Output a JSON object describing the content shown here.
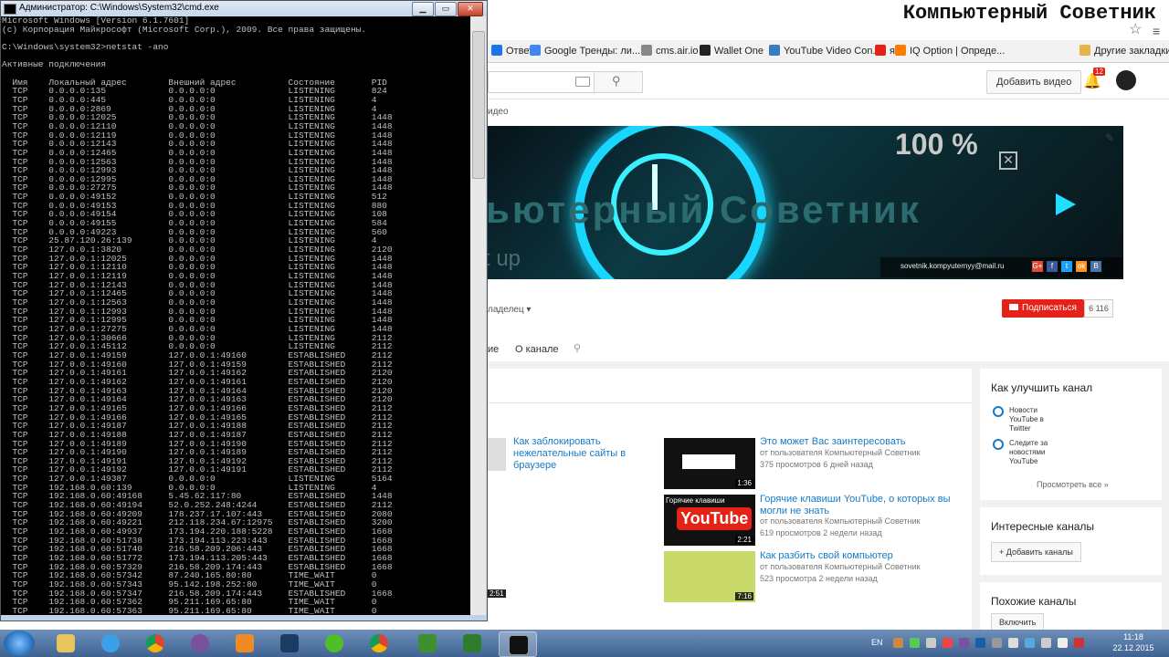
{
  "overlay": {
    "brand": "Компьютерный Советник"
  },
  "cmd": {
    "title": "Администратор: C:\\Windows\\System32\\cmd.exe",
    "lines": [
      "Microsoft Windows [Version 6.1.7601]",
      "(c) Корпорация Майкрософт (Microsoft Corp.), 2009. Все права защищены.",
      "",
      "C:\\Windows\\system32>netstat -ano",
      "",
      "Активные подключения",
      "",
      "  Имя    Локальный адрес        Внешний адрес          Состояние       PID",
      "  TCP    0.0.0.0:135            0.0.0.0:0              LISTENING       824",
      "  TCP    0.0.0.0:445            0.0.0.0:0              LISTENING       4",
      "  TCP    0.0.0.0:2869           0.0.0.0:0              LISTENING       4",
      "  TCP    0.0.0.0:12025          0.0.0.0:0              LISTENING       1448",
      "  TCP    0.0.0.0:12110          0.0.0.0:0              LISTENING       1448",
      "  TCP    0.0.0.0:12119          0.0.0.0:0              LISTENING       1448",
      "  TCP    0.0.0.0:12143          0.0.0.0:0              LISTENING       1448",
      "  TCP    0.0.0.0:12465          0.0.0.0:0              LISTENING       1448",
      "  TCP    0.0.0.0:12563          0.0.0.0:0              LISTENING       1448",
      "  TCP    0.0.0.0:12993          0.0.0.0:0              LISTENING       1448",
      "  TCP    0.0.0.0:12995          0.0.0.0:0              LISTENING       1448",
      "  TCP    0.0.0.0:27275          0.0.0.0:0              LISTENING       1448",
      "  TCP    0.0.0.0:49152          0.0.0.0:0              LISTENING       512",
      "  TCP    0.0.0.0:49153          0.0.0.0:0              LISTENING       880",
      "  TCP    0.0.0.0:49154          0.0.0.0:0              LISTENING       108",
      "  TCP    0.0.0.0:49155          0.0.0.0:0              LISTENING       584",
      "  TCP    0.0.0.0:49223          0.0.0.0:0              LISTENING       560",
      "  TCP    25.87.120.26:139       0.0.0.0:0              LISTENING       4",
      "  TCP    127.0.0.1:3820         0.0.0.0:0              LISTENING       2120",
      "  TCP    127.0.0.1:12025        0.0.0.0:0              LISTENING       1448",
      "  TCP    127.0.0.1:12110        0.0.0.0:0              LISTENING       1448",
      "  TCP    127.0.0.1:12119        0.0.0.0:0              LISTENING       1448",
      "  TCP    127.0.0.1:12143        0.0.0.0:0              LISTENING       1448",
      "  TCP    127.0.0.1:12465        0.0.0.0:0              LISTENING       1448",
      "  TCP    127.0.0.1:12563        0.0.0.0:0              LISTENING       1448",
      "  TCP    127.0.0.1:12993        0.0.0.0:0              LISTENING       1448",
      "  TCP    127.0.0.1:12995        0.0.0.0:0              LISTENING       1448",
      "  TCP    127.0.0.1:27275        0.0.0.0:0              LISTENING       1448",
      "  TCP    127.0.0.1:30666        0.0.0.0:0              LISTENING       2112",
      "  TCP    127.0.0.1:45112        0.0.0.0:0              LISTENING       2112",
      "  TCP    127.0.0.1:49159        127.0.0.1:49160        ESTABLISHED     2112",
      "  TCP    127.0.0.1:49160        127.0.0.1:49159        ESTABLISHED     2112",
      "  TCP    127.0.0.1:49161        127.0.0.1:49162        ESTABLISHED     2120",
      "  TCP    127.0.0.1:49162        127.0.0.1:49161        ESTABLISHED     2120",
      "  TCP    127.0.0.1:49163        127.0.0.1:49164        ESTABLISHED     2120",
      "  TCP    127.0.0.1:49164        127.0.0.1:49163        ESTABLISHED     2120",
      "  TCP    127.0.0.1:49165        127.0.0.1:49166        ESTABLISHED     2112",
      "  TCP    127.0.0.1:49166        127.0.0.1:49165        ESTABLISHED     2112",
      "  TCP    127.0.0.1:49187        127.0.0.1:49188        ESTABLISHED     2112",
      "  TCP    127.0.0.1:49188        127.0.0.1:49187        ESTABLISHED     2112",
      "  TCP    127.0.0.1:49189        127.0.0.1:49190        ESTABLISHED     2112",
      "  TCP    127.0.0.1:49190        127.0.0.1:49189        ESTABLISHED     2112",
      "  TCP    127.0.0.1:49191        127.0.0.1:49192        ESTABLISHED     2112",
      "  TCP    127.0.0.1:49192        127.0.0.1:49191        ESTABLISHED     2112",
      "  TCP    127.0.0.1:49387        0.0.0.0:0              LISTENING       5164",
      "  TCP    192.168.0.60:139       0.0.0.0:0              LISTENING       4",
      "  TCP    192.168.0.60:49168     5.45.62.117:80         ESTABLISHED     1448",
      "  TCP    192.168.0.60:49194     52.0.252.248:4244      ESTABLISHED     2112",
      "  TCP    192.168.0.60:49209     178.237.17.107:443     ESTABLISHED     2080",
      "  TCP    192.168.0.60:49221     212.118.234.67:12975   ESTABLISHED     3200",
      "  TCP    192.168.0.60:49937     173.194.220.188:5228   ESTABLISHED     1668",
      "  TCP    192.168.0.60:51738     173.194.113.223:443    ESTABLISHED     1668",
      "  TCP    192.168.0.60:51740     216.58.209.206:443     ESTABLISHED     1668",
      "  TCP    192.168.0.60:51772     173.194.113.205:443    ESTABLISHED     1668",
      "  TCP    192.168.0.60:57329     216.58.209.174:443     ESTABLISHED     1668",
      "  TCP    192.168.0.60:57342     87.240.165.80:80       TIME_WAIT       0",
      "  TCP    192.168.0.60:57343     95.142.198.252:80      TIME_WAIT       0",
      "  TCP    192.168.0.60:57347     216.58.209.174:443     ESTABLISHED     1668",
      "  TCP    192.168.0.60:57362     95.211.169.65:80       TIME_WAIT       0",
      "  TCP    192.168.0.60:57363     95.211.169.65:80       TIME_WAIT       0"
    ]
  },
  "bookmarks": [
    {
      "label": "Ответ",
      "color": "#1a73e8"
    },
    {
      "label": "Google Тренды: ли...",
      "color": "#4285f4"
    },
    {
      "label": "cms.air.io",
      "color": "#888888"
    },
    {
      "label": "Wallet One",
      "color": "#222222"
    },
    {
      "label": "YouTube Video Con...",
      "color": "#3b7bbf"
    },
    {
      "label": "я",
      "color": "#e62117"
    },
    {
      "label": "IQ Option | Опреде...",
      "color": "#ff7a00"
    },
    {
      "label": "Другие закладки",
      "color": "#e6b34a"
    }
  ],
  "youtube": {
    "add_video": "Добавить видео",
    "notif_count": "12",
    "crumb": "идео",
    "banner": {
      "big_text": "ьютерный Советник",
      "percent": "100 %",
      "tagline": "t up",
      "email": "sovetnik.kompyuternyy@mail.ru",
      "social": [
        "G+",
        "f",
        "t",
        "ok",
        "B"
      ]
    },
    "owner_label": "ладелец ▾",
    "subscribe_label": "Подписаться",
    "sub_count": "6 116",
    "tabs": [
      "ие",
      "О канале"
    ],
    "videos": [
      {
        "title": "Как заблокировать нежелательные сайты в браузере"
      },
      {
        "title": "Это может Вас заинтересовать",
        "author": "от пользователя Компьютерный Советник",
        "meta": "375 просмотров   6 дней назад",
        "duration": "1:36"
      },
      {
        "title": "Горячие клавиши YouTube, о которых вы могли не знать",
        "author": "от пользователя Компьютерный Советник",
        "meta": "619 просмотров   2 недели назад",
        "duration": "2:21",
        "thumb_top": "Горячие клавиши",
        "thumb_logo": "YouTube"
      },
      {
        "title": "Как разбить свой компьютер",
        "author": "от пользователя Компьютерный Советник",
        "meta": "523 просмотра   2 недели назад",
        "duration": "7:16"
      }
    ],
    "left_duration": "2:51",
    "side": {
      "improve_title": "Как улучшить канал",
      "option1": "Новости YouTube в Twitter",
      "option2": "Следите за новостями YouTube",
      "see_all": "Просмотреть все  »",
      "interesting_title": "Интересные каналы",
      "add_channels": "+ Добавить каналы",
      "similar_title": "Похожие каналы",
      "enable": "Включить"
    }
  },
  "taskbar": {
    "lang": "EN",
    "time": "11:18",
    "date": "22.12.2015"
  }
}
